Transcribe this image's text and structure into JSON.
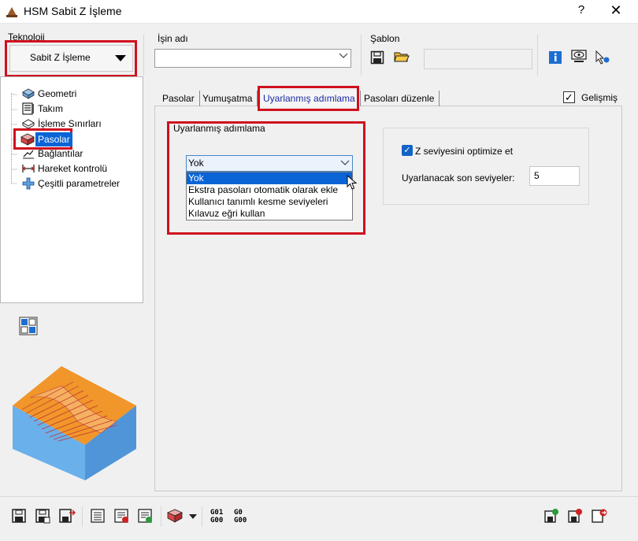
{
  "window": {
    "title": "HSM Sabit Z İşleme",
    "help": "?",
    "close": "✕"
  },
  "teknoloji": {
    "label": "Teknoloji",
    "value": "Sabit Z İşleme"
  },
  "is_adi": {
    "label": "İşin adı",
    "value": ""
  },
  "sablon": {
    "label": "Şablon",
    "value": ""
  },
  "tree": {
    "items": [
      {
        "label": "Geometri",
        "icon": "geometry-icon"
      },
      {
        "label": "Takım",
        "icon": "tool-icon"
      },
      {
        "label": "İşleme Sınırları",
        "icon": "limits-icon"
      },
      {
        "label": "Pasolar",
        "icon": "passes-icon",
        "selected": true
      },
      {
        "label": "Bağlantılar",
        "icon": "links-icon"
      },
      {
        "label": "Hareket kontrolü",
        "icon": "motion-control-icon"
      },
      {
        "label": "Çeşitli parametreler",
        "icon": "misc-params-icon"
      }
    ]
  },
  "tabs": [
    {
      "label": "Pasolar"
    },
    {
      "label": "Yumuşatma"
    },
    {
      "label": "Uyarlanmış adımlama",
      "active": true
    },
    {
      "label": "Pasoları düzenle"
    }
  ],
  "advanced": {
    "label": "Gelişmiş",
    "checked": true
  },
  "adaptive": {
    "group_label": "Uyarlanmış adımlama",
    "selected": "Yok",
    "options": [
      "Yok",
      "Ekstra pasoları otomatik olarak ekle",
      "Kullanıcı tanımlı kesme seviyeleri",
      "Kılavuz eğri kullan"
    ]
  },
  "z_optimize": {
    "label": "Z seviyesini optimize et",
    "checked": true
  },
  "levels": {
    "label": "Uyarlanacak son seviyeler:",
    "value": "5"
  },
  "toolbar": {
    "gcode_label_1_top": "G01",
    "gcode_label_1_bottom": "G00",
    "gcode_label_2_top": "G0",
    "gcode_label_2_bottom": "G00"
  },
  "colors": {
    "highlight_red": "#d0101e",
    "selection_blue": "#0a64d6",
    "part_orange": "#f0962a"
  }
}
